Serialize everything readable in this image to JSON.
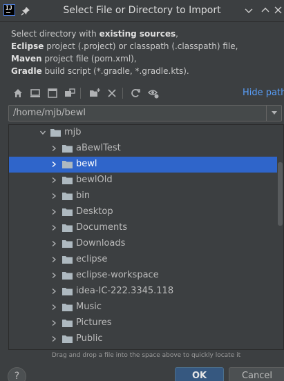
{
  "window": {
    "title": "Select File or Directory to Import"
  },
  "description": {
    "line1_prefix": "Select directory with ",
    "line1_bold": "existing sources",
    "line1_suffix": ",",
    "line2_bold": "Eclipse",
    "line2_rest": " project (.project) or classpath (.classpath) file,",
    "line3_bold": "Maven",
    "line3_rest": " project file (pom.xml),",
    "line4_bold": "Gradle",
    "line4_rest": " build script (*.gradle, *.gradle.kts)."
  },
  "toolbar": {
    "hide_path_label": "Hide path"
  },
  "path": {
    "value": "/home/mjb/bewl"
  },
  "tree": {
    "parent": {
      "label": "mjb",
      "expanded": true
    },
    "items": [
      {
        "label": "aBewlTest",
        "selected": false
      },
      {
        "label": "bewl",
        "selected": true
      },
      {
        "label": "bewlOld",
        "selected": false
      },
      {
        "label": "bin",
        "selected": false
      },
      {
        "label": "Desktop",
        "selected": false
      },
      {
        "label": "Documents",
        "selected": false
      },
      {
        "label": "Downloads",
        "selected": false
      },
      {
        "label": "eclipse",
        "selected": false
      },
      {
        "label": "eclipse-workspace",
        "selected": false
      },
      {
        "label": "idea-IC-222.3345.118",
        "selected": false
      },
      {
        "label": "Music",
        "selected": false
      },
      {
        "label": "Pictures",
        "selected": false
      },
      {
        "label": "Public",
        "selected": false
      }
    ]
  },
  "hint": "Drag and drop a file into the space above to quickly locate it",
  "buttons": {
    "help": "?",
    "ok": "OK",
    "cancel": "Cancel"
  },
  "colors": {
    "background": "#3c3f41",
    "selection": "#2f65ca",
    "link": "#589df6",
    "folder": "#aeb9c0",
    "ok_button": "#365880"
  }
}
